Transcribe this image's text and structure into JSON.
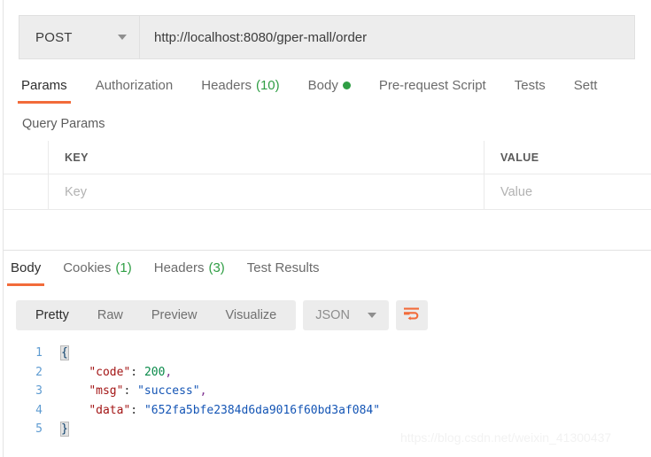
{
  "request": {
    "method": "POST",
    "method_caret_icon": "chevron-down-icon",
    "url": "http://localhost:8080/gper-mall/order",
    "url_placeholder": "Enter request URL"
  },
  "request_tabs": [
    {
      "label": "Params",
      "count": "",
      "dot": false,
      "active": true
    },
    {
      "label": "Authorization",
      "count": "",
      "dot": false,
      "active": false
    },
    {
      "label": "Headers",
      "count": "(10)",
      "dot": false,
      "active": false
    },
    {
      "label": "Body",
      "count": "",
      "dot": true,
      "active": false
    },
    {
      "label": "Pre-request Script",
      "count": "",
      "dot": false,
      "active": false
    },
    {
      "label": "Tests",
      "count": "",
      "dot": false,
      "active": false
    },
    {
      "label": "Sett",
      "count": "",
      "dot": false,
      "active": false
    }
  ],
  "query_params": {
    "title": "Query Params",
    "columns": [
      "KEY",
      "VALUE"
    ],
    "rows": [
      {
        "key": "Key",
        "value": "Value",
        "is_placeholder": true
      }
    ]
  },
  "response_tabs": [
    {
      "label": "Body",
      "count": "",
      "active": true
    },
    {
      "label": "Cookies",
      "count": "(1)",
      "active": false
    },
    {
      "label": "Headers",
      "count": "(3)",
      "active": false
    },
    {
      "label": "Test Results",
      "count": "",
      "active": false
    }
  ],
  "format_bar": {
    "views": [
      {
        "label": "Pretty",
        "active": true
      },
      {
        "label": "Raw",
        "active": false
      },
      {
        "label": "Preview",
        "active": false
      },
      {
        "label": "Visualize",
        "active": false
      }
    ],
    "language": "JSON",
    "language_caret_icon": "chevron-down-icon",
    "wrap_lines_icon": "wrap-text-icon"
  },
  "response_body": {
    "language": "json",
    "line_numbers": [
      "1",
      "2",
      "3",
      "4",
      "5"
    ],
    "lines": [
      {
        "n": "1",
        "segments": [
          {
            "t": "{",
            "c": "tok-brace"
          }
        ]
      },
      {
        "n": "2",
        "segments": [
          {
            "t": "    ",
            "c": ""
          },
          {
            "t": "\"code\"",
            "c": "tok-key"
          },
          {
            "t": ": ",
            "c": ""
          },
          {
            "t": "200",
            "c": "tok-num"
          },
          {
            "t": ",",
            "c": "tok-punc"
          }
        ]
      },
      {
        "n": "3",
        "segments": [
          {
            "t": "    ",
            "c": ""
          },
          {
            "t": "\"msg\"",
            "c": "tok-key"
          },
          {
            "t": ": ",
            "c": ""
          },
          {
            "t": "\"success\"",
            "c": "tok-str"
          },
          {
            "t": ",",
            "c": "tok-punc"
          }
        ]
      },
      {
        "n": "4",
        "segments": [
          {
            "t": "    ",
            "c": ""
          },
          {
            "t": "\"data\"",
            "c": "tok-key"
          },
          {
            "t": ": ",
            "c": ""
          },
          {
            "t": "\"652fa5bfe2384d6da9016f60bd3af084\"",
            "c": "tok-str"
          }
        ]
      },
      {
        "n": "5",
        "segments": [
          {
            "t": "}",
            "c": "tok-brace"
          }
        ]
      }
    ],
    "parsed": {
      "code": 200,
      "msg": "success",
      "data": "652fa5bfe2384d6da9016f60bd3af084"
    }
  },
  "watermark": "https://blog.csdn.net/weixin_41300437",
  "colors": {
    "accent": "#f26b3a",
    "count_green": "#2f9e44",
    "toolbar_bg": "#ececec",
    "field_bg": "#ededed",
    "border": "#e0e0e0",
    "text": "#2e2e2e",
    "muted": "#6b6b6b",
    "placeholder": "#b2b2b2",
    "json_key": "#a31515",
    "json_string": "#1455b5",
    "json_number": "#0a8a4a",
    "line_number": "#5e9bd1"
  }
}
